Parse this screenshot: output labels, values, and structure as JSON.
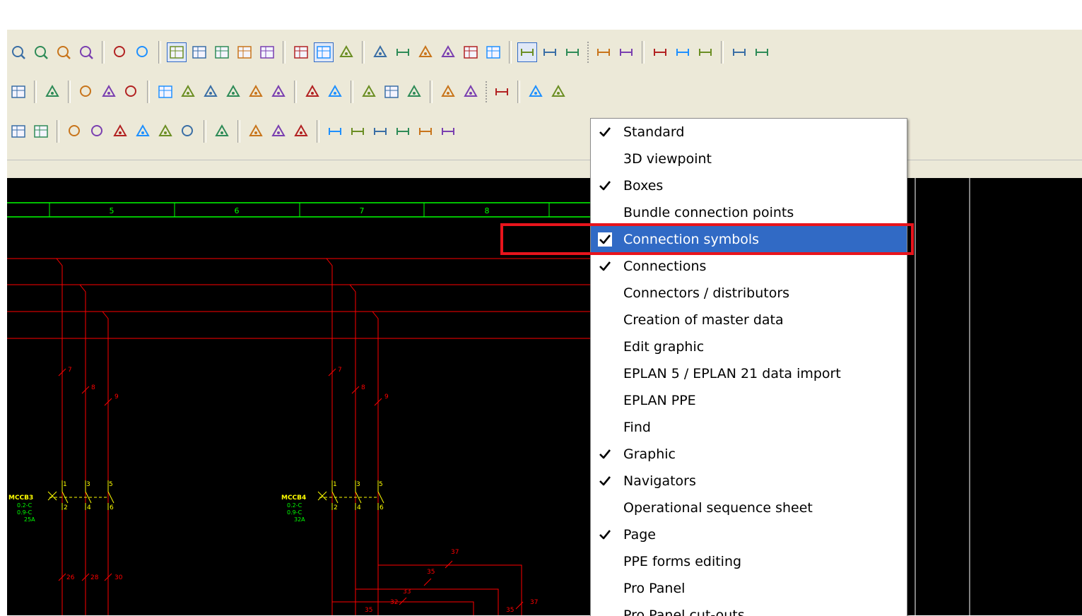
{
  "menu": {
    "items": [
      {
        "label": "Standard",
        "checked": true
      },
      {
        "label": "3D viewpoint",
        "checked": false
      },
      {
        "label": "Boxes",
        "checked": true
      },
      {
        "label": "Bundle connection points",
        "checked": false
      },
      {
        "label": "Connection symbols",
        "checked": true,
        "highlighted": true
      },
      {
        "label": "Connections",
        "checked": true
      },
      {
        "label": "Connectors / distributors",
        "checked": false
      },
      {
        "label": "Creation of master data",
        "checked": false
      },
      {
        "label": "Edit graphic",
        "checked": false
      },
      {
        "label": "EPLAN 5 / EPLAN 21 data import",
        "checked": false
      },
      {
        "label": "EPLAN PPE",
        "checked": false
      },
      {
        "label": "Find",
        "checked": false
      },
      {
        "label": "Graphic",
        "checked": true
      },
      {
        "label": "Navigators",
        "checked": true
      },
      {
        "label": "Operational sequence sheet",
        "checked": false
      },
      {
        "label": "Page",
        "checked": true
      },
      {
        "label": "PPE forms editing",
        "checked": false
      },
      {
        "label": "Pro Panel",
        "checked": false
      },
      {
        "label": "Pro Panel cut-outs",
        "checked": false
      }
    ]
  },
  "schematic": {
    "columns": [
      "5",
      "6",
      "7",
      "8"
    ],
    "devices": [
      {
        "tag": "MCCB3",
        "ranges": [
          "0.2-C",
          "0.9-C"
        ],
        "rating": "25A"
      },
      {
        "tag": "MCCB4",
        "ranges": [
          "0.2-C",
          "0.9-C"
        ],
        "rating": "32A"
      }
    ],
    "wire_numbers": {
      "left_top": [
        "7",
        "8",
        "9"
      ],
      "right_top": [
        "7",
        "8",
        "9"
      ],
      "left_terminals_top": [
        "1",
        "3",
        "5"
      ],
      "left_terminals_bottom": [
        "2",
        "4",
        "6"
      ],
      "right_terminals_top": [
        "1",
        "3",
        "5"
      ],
      "right_terminals_bottom": [
        "2",
        "4",
        "6"
      ],
      "left_bottom": [
        "26",
        "28",
        "30"
      ],
      "right_bottom": [
        "37",
        "35",
        "33",
        "32",
        "35",
        "35",
        "37"
      ]
    }
  },
  "toolbar": {
    "row1_icons": [
      "zoom-window-icon",
      "zoom-in-icon",
      "zoom-out-icon",
      "zoom-100-icon",
      "go-back-icon",
      "go-forward-icon",
      "grid-a-icon",
      "grid-b-icon",
      "grid-c-icon",
      "grid-d-icon",
      "grid-e-icon",
      "grid-show-icon",
      "snap-grid-icon",
      "snap-point-icon",
      "magnet-icon",
      "measure-icon",
      "tree-icon",
      "number-icon",
      "field-icon",
      "input-field-icon",
      "lines-icon",
      "lines-2-icon",
      "lines-3-icon",
      "wire-icon",
      "wire-cross-icon",
      "wire-t-icon",
      "wire-angle-icon",
      "wire-node-icon",
      "wire-jump-icon",
      "wire-break-icon"
    ],
    "row2_icons": [
      "macro-icon",
      "device-icon",
      "plc-icon",
      "contact-icon",
      "coil-icon",
      "terminal-icon",
      "connector-icon",
      "cable-icon",
      "shield-icon",
      "potential-icon",
      "arrow-icon",
      "bus-icon",
      "plug-icon",
      "socket-icon",
      "panel-icon",
      "hatch-icon",
      "fill-icon",
      "move-icon",
      "dimension-icon",
      "cart-icon",
      "text-image-icon"
    ],
    "row3_icons": [
      "rectangle-icon",
      "box-icon",
      "circle-icon",
      "ellipse-icon",
      "arc-icon",
      "curve-icon",
      "pie-icon",
      "eye-icon",
      "polyline-icon",
      "text-icon",
      "image-icon",
      "pen-icon",
      "dim-linear-icon",
      "dim-aligned-icon",
      "dim-chain-icon",
      "dim-baseline-icon",
      "dim-increment-icon",
      "dim-angle-icon"
    ]
  },
  "colors": {
    "canvas": "#000000",
    "wire": "#ff0000",
    "frame": "#00ff00",
    "device": "#ffff00",
    "menu_highlight": "#316ac5",
    "annotation": "#e8141c"
  }
}
